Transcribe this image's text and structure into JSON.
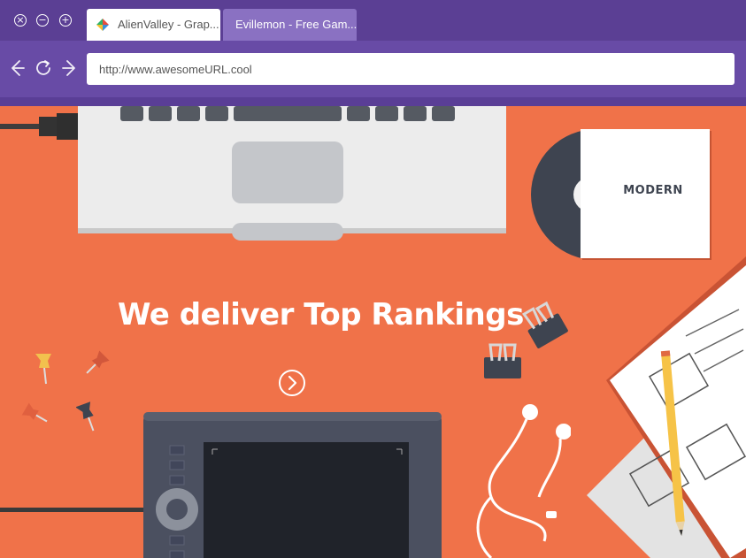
{
  "window": {
    "controls": [
      {
        "name": "close",
        "glyph": "×"
      },
      {
        "name": "minimize",
        "glyph": "−"
      },
      {
        "name": "maximize",
        "glyph": "+"
      }
    ]
  },
  "tabs": [
    {
      "label": "AlienValley - Grap...",
      "active": true
    },
    {
      "label": "Evillemon - Free Gam...",
      "active": false
    }
  ],
  "address_bar": {
    "value": "http://www.awesomeURL.cool"
  },
  "hero": {
    "headline": "We deliver Top Rankings",
    "cd_logo": "MODERN"
  },
  "colors": {
    "titlebar": "#5b3f94",
    "navbar": "#684ba6",
    "tab_inactive": "#8a71c2",
    "background": "#f07249",
    "accent_teal": "#3fbdb5"
  }
}
